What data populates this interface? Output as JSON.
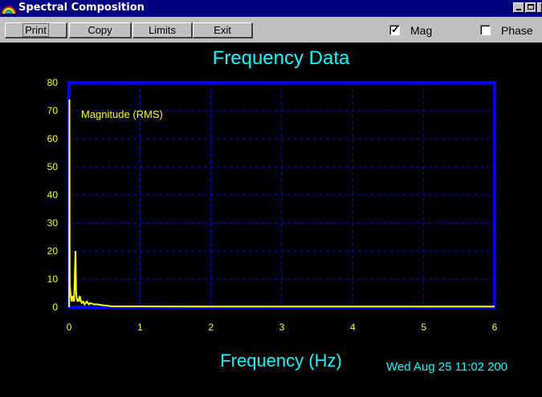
{
  "window": {
    "title": "Spectral Composition",
    "app_icon": "rainbow-icon"
  },
  "toolbar": {
    "print_label": "Print",
    "copy_label": "Copy",
    "limits_label": "Limits",
    "exit_label": "Exit",
    "mag_label": "Mag",
    "mag_checked": true,
    "phase_label": "Phase",
    "phase_checked": false
  },
  "status": {
    "timestamp": "Wed Aug 25 11:02 200"
  },
  "colors": {
    "title_bar": "#000080",
    "plot_background": "#000000",
    "frame": "#0000ff",
    "grid": "#0000ff",
    "series": "#ffff00",
    "title_text": "#00ffff",
    "tick_text": "#ffff00"
  },
  "chart_data": {
    "type": "line",
    "title": "Frequency Data",
    "xlabel": "Frequency (Hz)",
    "ylabel": "",
    "xlim": [
      0,
      6
    ],
    "ylim": [
      0,
      80
    ],
    "x_ticks": [
      "0",
      "1",
      "2",
      "3",
      "4",
      "5",
      "6"
    ],
    "y_ticks": [
      "0",
      "10",
      "20",
      "30",
      "40",
      "50",
      "60",
      "70",
      "80"
    ],
    "grid": true,
    "grid_style": "dashed",
    "series": [
      {
        "name": "Magnitude (RMS)",
        "x": [
          0,
          0.005,
          0.01,
          0.02,
          0.03,
          0.04,
          0.05,
          0.06,
          0.07,
          0.08,
          0.09,
          0.1,
          0.11,
          0.12,
          0.13,
          0.14,
          0.15,
          0.16,
          0.17,
          0.18,
          0.2,
          0.22,
          0.25,
          0.28,
          0.3,
          0.35,
          0.4,
          0.45,
          0.5,
          0.55,
          0.6,
          1,
          2,
          3,
          4,
          5,
          6
        ],
        "y": [
          0,
          74,
          8,
          5,
          3,
          2,
          4,
          3,
          2,
          10,
          20,
          5,
          3,
          2,
          3,
          2,
          4,
          3,
          2,
          1.5,
          2,
          1,
          2,
          1,
          1.5,
          1,
          1,
          0.8,
          0.6,
          0.5,
          0.3,
          0.3,
          0.2,
          0.2,
          0.2,
          0.2,
          0.2
        ]
      }
    ]
  }
}
